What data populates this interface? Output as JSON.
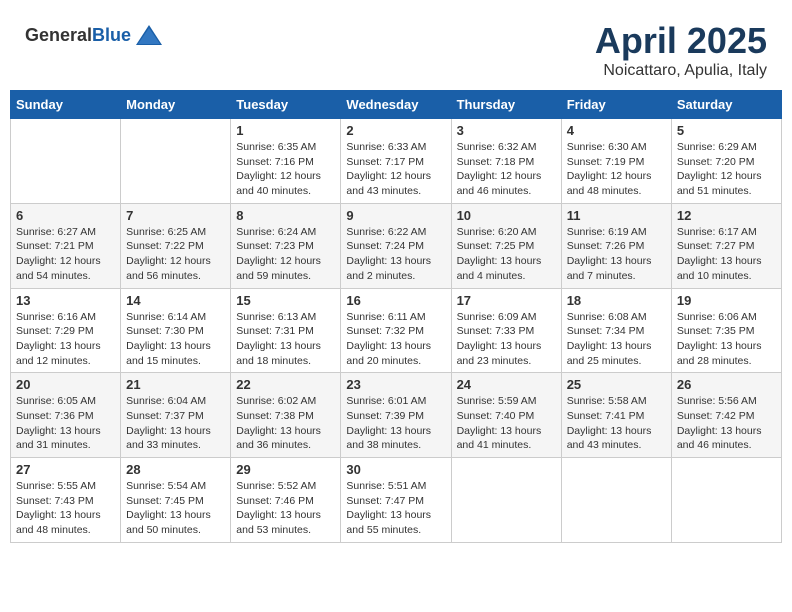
{
  "header": {
    "logo_general": "General",
    "logo_blue": "Blue",
    "month_year": "April 2025",
    "location": "Noicattaro, Apulia, Italy"
  },
  "weekdays": [
    "Sunday",
    "Monday",
    "Tuesday",
    "Wednesday",
    "Thursday",
    "Friday",
    "Saturday"
  ],
  "weeks": [
    [
      {
        "day": "",
        "info": ""
      },
      {
        "day": "",
        "info": ""
      },
      {
        "day": "1",
        "info": "Sunrise: 6:35 AM\nSunset: 7:16 PM\nDaylight: 12 hours and 40 minutes."
      },
      {
        "day": "2",
        "info": "Sunrise: 6:33 AM\nSunset: 7:17 PM\nDaylight: 12 hours and 43 minutes."
      },
      {
        "day": "3",
        "info": "Sunrise: 6:32 AM\nSunset: 7:18 PM\nDaylight: 12 hours and 46 minutes."
      },
      {
        "day": "4",
        "info": "Sunrise: 6:30 AM\nSunset: 7:19 PM\nDaylight: 12 hours and 48 minutes."
      },
      {
        "day": "5",
        "info": "Sunrise: 6:29 AM\nSunset: 7:20 PM\nDaylight: 12 hours and 51 minutes."
      }
    ],
    [
      {
        "day": "6",
        "info": "Sunrise: 6:27 AM\nSunset: 7:21 PM\nDaylight: 12 hours and 54 minutes."
      },
      {
        "day": "7",
        "info": "Sunrise: 6:25 AM\nSunset: 7:22 PM\nDaylight: 12 hours and 56 minutes."
      },
      {
        "day": "8",
        "info": "Sunrise: 6:24 AM\nSunset: 7:23 PM\nDaylight: 12 hours and 59 minutes."
      },
      {
        "day": "9",
        "info": "Sunrise: 6:22 AM\nSunset: 7:24 PM\nDaylight: 13 hours and 2 minutes."
      },
      {
        "day": "10",
        "info": "Sunrise: 6:20 AM\nSunset: 7:25 PM\nDaylight: 13 hours and 4 minutes."
      },
      {
        "day": "11",
        "info": "Sunrise: 6:19 AM\nSunset: 7:26 PM\nDaylight: 13 hours and 7 minutes."
      },
      {
        "day": "12",
        "info": "Sunrise: 6:17 AM\nSunset: 7:27 PM\nDaylight: 13 hours and 10 minutes."
      }
    ],
    [
      {
        "day": "13",
        "info": "Sunrise: 6:16 AM\nSunset: 7:29 PM\nDaylight: 13 hours and 12 minutes."
      },
      {
        "day": "14",
        "info": "Sunrise: 6:14 AM\nSunset: 7:30 PM\nDaylight: 13 hours and 15 minutes."
      },
      {
        "day": "15",
        "info": "Sunrise: 6:13 AM\nSunset: 7:31 PM\nDaylight: 13 hours and 18 minutes."
      },
      {
        "day": "16",
        "info": "Sunrise: 6:11 AM\nSunset: 7:32 PM\nDaylight: 13 hours and 20 minutes."
      },
      {
        "day": "17",
        "info": "Sunrise: 6:09 AM\nSunset: 7:33 PM\nDaylight: 13 hours and 23 minutes."
      },
      {
        "day": "18",
        "info": "Sunrise: 6:08 AM\nSunset: 7:34 PM\nDaylight: 13 hours and 25 minutes."
      },
      {
        "day": "19",
        "info": "Sunrise: 6:06 AM\nSunset: 7:35 PM\nDaylight: 13 hours and 28 minutes."
      }
    ],
    [
      {
        "day": "20",
        "info": "Sunrise: 6:05 AM\nSunset: 7:36 PM\nDaylight: 13 hours and 31 minutes."
      },
      {
        "day": "21",
        "info": "Sunrise: 6:04 AM\nSunset: 7:37 PM\nDaylight: 13 hours and 33 minutes."
      },
      {
        "day": "22",
        "info": "Sunrise: 6:02 AM\nSunset: 7:38 PM\nDaylight: 13 hours and 36 minutes."
      },
      {
        "day": "23",
        "info": "Sunrise: 6:01 AM\nSunset: 7:39 PM\nDaylight: 13 hours and 38 minutes."
      },
      {
        "day": "24",
        "info": "Sunrise: 5:59 AM\nSunset: 7:40 PM\nDaylight: 13 hours and 41 minutes."
      },
      {
        "day": "25",
        "info": "Sunrise: 5:58 AM\nSunset: 7:41 PM\nDaylight: 13 hours and 43 minutes."
      },
      {
        "day": "26",
        "info": "Sunrise: 5:56 AM\nSunset: 7:42 PM\nDaylight: 13 hours and 46 minutes."
      }
    ],
    [
      {
        "day": "27",
        "info": "Sunrise: 5:55 AM\nSunset: 7:43 PM\nDaylight: 13 hours and 48 minutes."
      },
      {
        "day": "28",
        "info": "Sunrise: 5:54 AM\nSunset: 7:45 PM\nDaylight: 13 hours and 50 minutes."
      },
      {
        "day": "29",
        "info": "Sunrise: 5:52 AM\nSunset: 7:46 PM\nDaylight: 13 hours and 53 minutes."
      },
      {
        "day": "30",
        "info": "Sunrise: 5:51 AM\nSunset: 7:47 PM\nDaylight: 13 hours and 55 minutes."
      },
      {
        "day": "",
        "info": ""
      },
      {
        "day": "",
        "info": ""
      },
      {
        "day": "",
        "info": ""
      }
    ]
  ]
}
